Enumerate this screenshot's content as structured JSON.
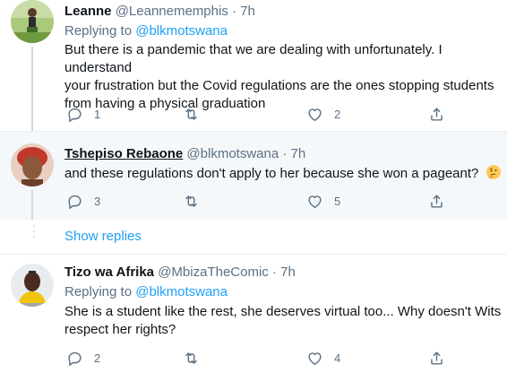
{
  "replies": [
    {
      "name": "Leanne",
      "handle": "@Leannememphis",
      "time": "7h",
      "replying_label": "Replying to",
      "replying_to": "@blkmotswana",
      "lines": [
        "But there is a pandemic that we are dealing with unfortunately. I understand",
        "your frustration but the Covid regulations are the ones stopping students",
        "from having a physical graduation"
      ],
      "reply_count": "1",
      "retweet_count": "",
      "like_count": "2"
    },
    {
      "name": "Tshepiso Rebaone",
      "handle": "@blkmotswana",
      "time": "7h",
      "text": "and these regulations don't apply to her because she won a pageant?",
      "emoji": "🤔",
      "reply_count": "3",
      "retweet_count": "",
      "like_count": "5"
    },
    {
      "name": "Tizo wa Afrika",
      "handle": "@MbizaTheComic",
      "time": "7h",
      "replying_label": "Replying to",
      "replying_to": "@blkmotswana",
      "lines": [
        "She is a student like the rest, she deserves virtual too... Why doesn't Wits",
        "respect her rights?"
      ],
      "reply_count": "2",
      "retweet_count": "",
      "like_count": "4"
    }
  ],
  "show_replies": "Show replies",
  "colors": {
    "link": "#1da1f2",
    "secondary_text": "#5b7083",
    "highlight_bg": "#f5f8fa",
    "divider": "#ebeef0"
  },
  "icons": [
    "reply-icon",
    "retweet-icon",
    "like-icon",
    "share-icon",
    "thinking-face-emoji"
  ]
}
